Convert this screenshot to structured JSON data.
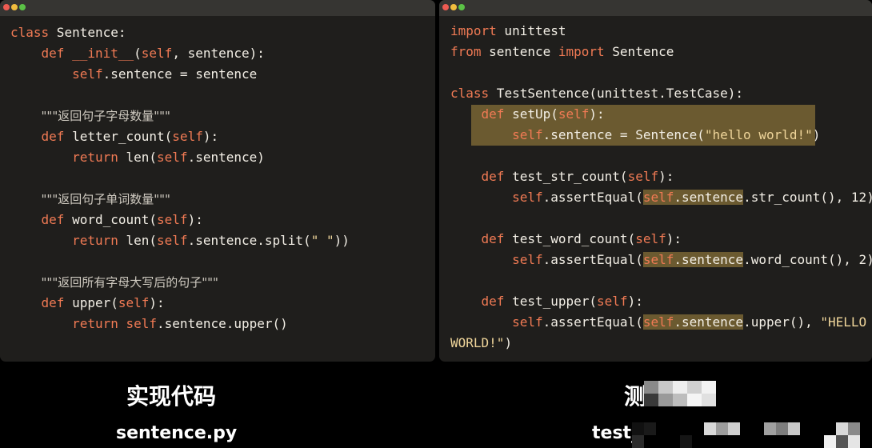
{
  "left_window": {
    "lines": [
      [
        {
          "t": "class",
          "c": "kw"
        },
        {
          "t": " Sentence:",
          "c": "fn"
        }
      ],
      [
        {
          "t": "    "
        },
        {
          "t": "def",
          "c": "kw"
        },
        {
          "t": " ",
          "c": "fn"
        },
        {
          "t": "__init__",
          "c": "kw"
        },
        {
          "t": "(",
          "c": "fn"
        },
        {
          "t": "self",
          "c": "self"
        },
        {
          "t": ", sentence):",
          "c": "fn"
        }
      ],
      [
        {
          "t": "        "
        },
        {
          "t": "self",
          "c": "self"
        },
        {
          "t": ".sentence = sentence",
          "c": "fn"
        }
      ],
      [],
      [
        {
          "t": "    "
        },
        {
          "t": "\"\"\"返回句子字母数量\"\"\"",
          "c": "cm"
        }
      ],
      [
        {
          "t": "    "
        },
        {
          "t": "def",
          "c": "kw"
        },
        {
          "t": " letter_count(",
          "c": "fn"
        },
        {
          "t": "self",
          "c": "self"
        },
        {
          "t": "):",
          "c": "fn"
        }
      ],
      [
        {
          "t": "        "
        },
        {
          "t": "return",
          "c": "kw"
        },
        {
          "t": " len(",
          "c": "fn"
        },
        {
          "t": "self",
          "c": "self"
        },
        {
          "t": ".sentence)",
          "c": "fn"
        }
      ],
      [],
      [
        {
          "t": "    "
        },
        {
          "t": "\"\"\"返回句子单词数量\"\"\"",
          "c": "cm"
        }
      ],
      [
        {
          "t": "    "
        },
        {
          "t": "def",
          "c": "kw"
        },
        {
          "t": " word_count(",
          "c": "fn"
        },
        {
          "t": "self",
          "c": "self"
        },
        {
          "t": "):",
          "c": "fn"
        }
      ],
      [
        {
          "t": "        "
        },
        {
          "t": "return",
          "c": "kw"
        },
        {
          "t": " len(",
          "c": "fn"
        },
        {
          "t": "self",
          "c": "self"
        },
        {
          "t": ".sentence.split(",
          "c": "fn"
        },
        {
          "t": "\" \"",
          "c": "str"
        },
        {
          "t": "))",
          "c": "fn"
        }
      ],
      [],
      [
        {
          "t": "    "
        },
        {
          "t": "\"\"\"返回所有字母大写后的句子\"\"\"",
          "c": "cm"
        }
      ],
      [
        {
          "t": "    "
        },
        {
          "t": "def",
          "c": "kw"
        },
        {
          "t": " upper(",
          "c": "fn"
        },
        {
          "t": "self",
          "c": "self"
        },
        {
          "t": "):",
          "c": "fn"
        }
      ],
      [
        {
          "t": "        "
        },
        {
          "t": "return",
          "c": "kw"
        },
        {
          "t": " ",
          "c": "fn"
        },
        {
          "t": "self",
          "c": "self"
        },
        {
          "t": ".sentence.upper()",
          "c": "fn"
        }
      ]
    ]
  },
  "right_window": {
    "lines": [
      [
        {
          "t": "import",
          "c": "kw"
        },
        {
          "t": " unittest",
          "c": "fn"
        }
      ],
      [
        {
          "t": "from",
          "c": "kw"
        },
        {
          "t": " sentence ",
          "c": "fn"
        },
        {
          "t": "import",
          "c": "kw"
        },
        {
          "t": " Sentence",
          "c": "fn"
        }
      ],
      [],
      [
        {
          "t": "class",
          "c": "kw"
        },
        {
          "t": " TestSentence(unittest.TestCase):",
          "c": "fn"
        }
      ],
      [
        {
          "t": "    "
        },
        {
          "t": "def",
          "c": "kw"
        },
        {
          "t": " setUp(",
          "c": "fn"
        },
        {
          "t": "self",
          "c": "self"
        },
        {
          "t": "):",
          "c": "fn"
        }
      ],
      [
        {
          "t": "        "
        },
        {
          "t": "self",
          "c": "self"
        },
        {
          "t": ".sentence = Sentence(",
          "c": "fn"
        },
        {
          "t": "\"hello world!\"",
          "c": "str"
        },
        {
          "t": ")",
          "c": "fn"
        }
      ],
      [],
      [
        {
          "t": "    "
        },
        {
          "t": "def",
          "c": "kw"
        },
        {
          "t": " test_str_count(",
          "c": "fn"
        },
        {
          "t": "self",
          "c": "self"
        },
        {
          "t": "):",
          "c": "fn"
        }
      ],
      [
        {
          "t": "        "
        },
        {
          "t": "self",
          "c": "self"
        },
        {
          "t": ".assertEqual(",
          "c": "fn"
        },
        {
          "t": "self",
          "c": "self",
          "h": 1
        },
        {
          "t": ".sentence",
          "c": "fn",
          "h": 1
        },
        {
          "t": ".str_count(), 12)",
          "c": "fn"
        }
      ],
      [],
      [
        {
          "t": "    "
        },
        {
          "t": "def",
          "c": "kw"
        },
        {
          "t": " test_word_count(",
          "c": "fn"
        },
        {
          "t": "self",
          "c": "self"
        },
        {
          "t": "):",
          "c": "fn"
        }
      ],
      [
        {
          "t": "        "
        },
        {
          "t": "self",
          "c": "self"
        },
        {
          "t": ".assertEqual(",
          "c": "fn"
        },
        {
          "t": "self",
          "c": "self",
          "h": 1
        },
        {
          "t": ".sentence",
          "c": "fn",
          "h": 1
        },
        {
          "t": ".word_count(), 2)",
          "c": "fn"
        }
      ],
      [],
      [
        {
          "t": "    "
        },
        {
          "t": "def",
          "c": "kw"
        },
        {
          "t": " test_upper(",
          "c": "fn"
        },
        {
          "t": "self",
          "c": "self"
        },
        {
          "t": "):",
          "c": "fn"
        }
      ],
      [
        {
          "t": "        "
        },
        {
          "t": "self",
          "c": "self"
        },
        {
          "t": ".assertEqual(",
          "c": "fn"
        },
        {
          "t": "self",
          "c": "self",
          "h": 1
        },
        {
          "t": ".sentence",
          "c": "fn",
          "h": 1
        },
        {
          "t": ".upper(), ",
          "c": "fn"
        },
        {
          "t": "\"HELLO",
          "c": "str"
        }
      ],
      [
        {
          "t": "WORLD!\"",
          "c": "str"
        },
        {
          "t": ")",
          "c": "fn"
        }
      ]
    ]
  },
  "captions": {
    "left_title": "实现代码",
    "left_file": "sentence.py",
    "right_title_visible": "测",
    "right_file_visible": "test_"
  },
  "colors": {
    "keyword": "#f07a54",
    "string": "#efd59a",
    "highlight": "#6b5a30",
    "background": "#1f1e1c"
  }
}
